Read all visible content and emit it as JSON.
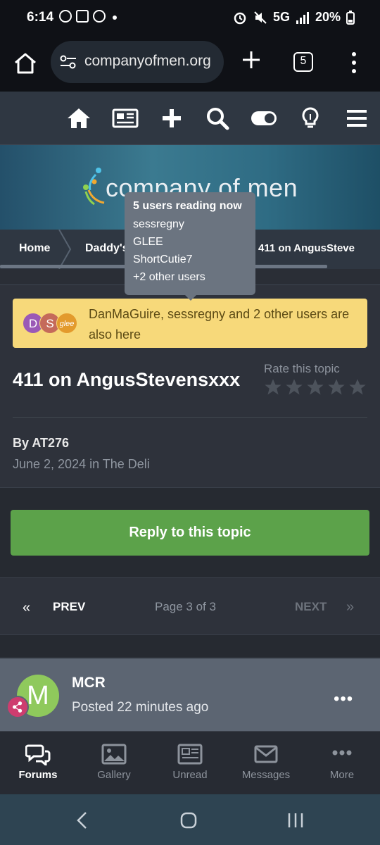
{
  "status_bar": {
    "time": "6:14",
    "network": "5G",
    "battery": "20%"
  },
  "browser": {
    "url": "companyofmen.org",
    "tab_count": "5"
  },
  "site": {
    "brand": "company of men"
  },
  "breadcrumb": {
    "items": [
      "Home",
      "Daddy's",
      "411 on AngusSteve"
    ]
  },
  "tooltip": {
    "title": "5 users reading now",
    "users": [
      "sessregny",
      "GLEE",
      "ShortCutie7"
    ],
    "more": "+2 other users"
  },
  "also_here": {
    "avatars": [
      {
        "letter": "D",
        "color": "#9b59b6"
      },
      {
        "letter": "S",
        "color": "#c56a5a"
      },
      {
        "letter": "glee",
        "color": "#e39a2c"
      }
    ],
    "text": "DanMaGuire, sessregny and 2 other users are also here"
  },
  "topic": {
    "title": "411 on AngusStevensxxx",
    "rate_label": "Rate this topic",
    "rating": 0,
    "by": "By AT276",
    "date": "June 2, 2024 in The Deli"
  },
  "reply_button": "Reply to this topic",
  "pager": {
    "prev": "PREV",
    "info": "Page 3 of 3",
    "next": "NEXT"
  },
  "post": {
    "avatar_letter": "M",
    "name": "MCR",
    "posted": "Posted 22 minutes ago",
    "more": "•••"
  },
  "tabbar": {
    "items": [
      {
        "label": "Forums",
        "icon": "forums-icon",
        "active": true
      },
      {
        "label": "Gallery",
        "icon": "gallery-icon",
        "active": false
      },
      {
        "label": "Unread",
        "icon": "unread-icon",
        "active": false
      },
      {
        "label": "Messages",
        "icon": "messages-icon",
        "active": false
      },
      {
        "label": "More",
        "icon": "more-icon",
        "active": false
      }
    ]
  },
  "colors": {
    "accent_green": "#5ca24a",
    "alert_yellow": "#f7d97a",
    "nav_bg": "#2f3742"
  }
}
